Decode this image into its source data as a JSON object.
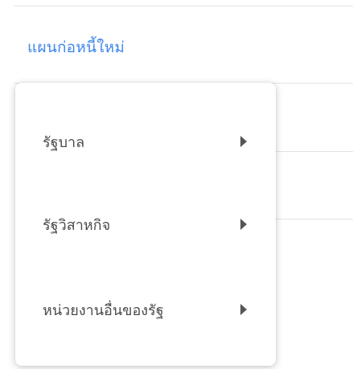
{
  "page": {
    "link_text": "แผนก่อหนี้ใหม่"
  },
  "menu": {
    "items": [
      {
        "label": "รัฐบาล",
        "icon": "caret-right-icon"
      },
      {
        "label": "รัฐวิสาหกิจ",
        "icon": "caret-right-icon"
      },
      {
        "label": "หน่วยงานอื่นของรัฐ",
        "icon": "caret-right-icon"
      }
    ]
  },
  "colors": {
    "link": "#3f87ea",
    "text": "#4b4b4b",
    "arrow": "#555555",
    "divider": "#e3e3e3"
  }
}
